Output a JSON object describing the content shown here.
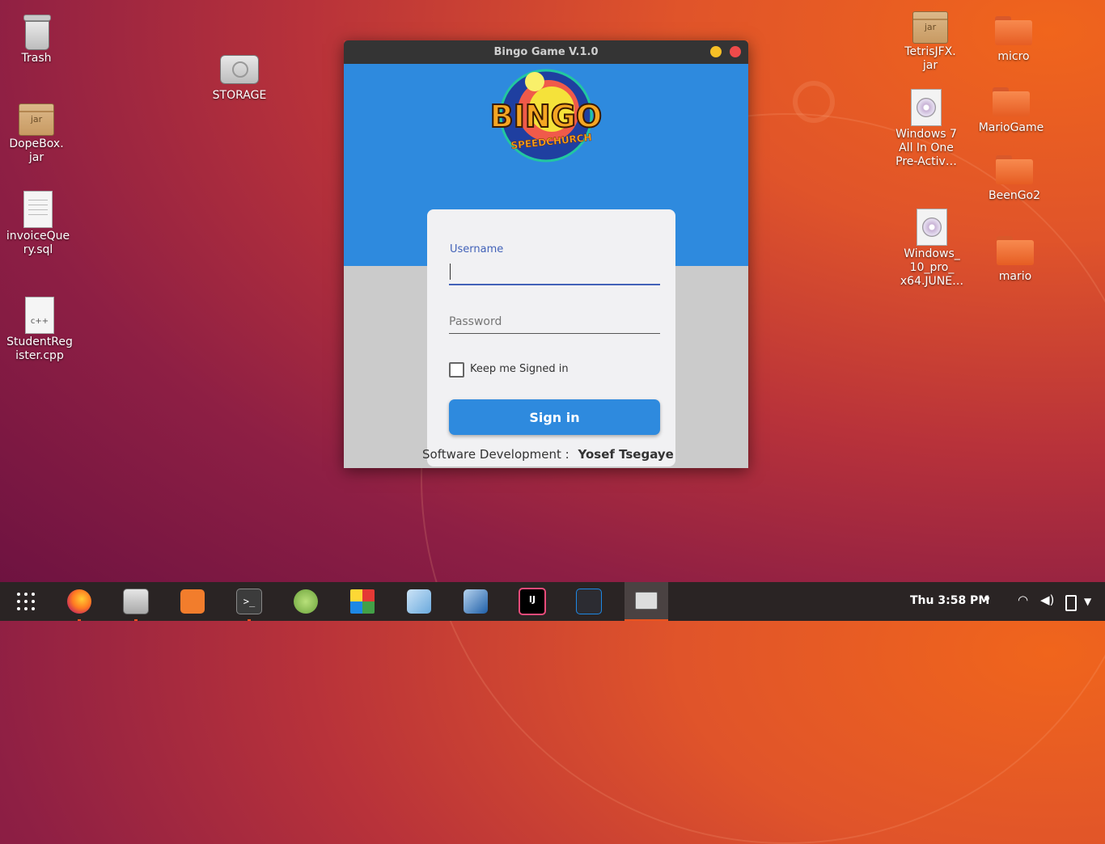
{
  "desktop": {
    "icons": [
      {
        "label": "Trash"
      },
      {
        "label": "DopeBox.\njar",
        "badge": "jar"
      },
      {
        "label": "invoiceQue\nry.sql"
      },
      {
        "label": "StudentReg\nister.cpp",
        "badge": "c++"
      },
      {
        "label": "STORAGE"
      },
      {
        "label": "TetrisJFX.\njar",
        "badge": "jar"
      },
      {
        "label": "Windows 7\nAll In One\nPre-Activ…"
      },
      {
        "label": "Windows_\n10_pro_\nx64.JUNE…"
      },
      {
        "label": "micro"
      },
      {
        "label": "MarioGame"
      },
      {
        "label": "BeenGo2"
      },
      {
        "label": "mario"
      }
    ]
  },
  "window": {
    "title": "Bingo Game V.1.0",
    "logo_text": "BINGO",
    "logo_subtext": "SPEEDCHURCH",
    "username_label": "Username",
    "username_value": "",
    "password_placeholder": "Password",
    "keep_signed_in_label": "Keep me Signed in",
    "keep_signed_in_checked": false,
    "signin_label": "Sign in",
    "footer_prefix": "Software Development :",
    "footer_name": "Yosef Tsegaye"
  },
  "taskbar": {
    "apps": [
      "show-apps",
      "firefox",
      "files",
      "software-center",
      "terminal",
      "android-studio",
      "windows-app",
      "virtualbox-cube",
      "virtualbox",
      "intellij",
      "vscode",
      "bingo-app"
    ],
    "clock": "Thu  3:58 PM",
    "accent": "#e95420"
  },
  "colors": {
    "window_blue": "#2e8ade",
    "label_blue": "#4262b8"
  }
}
